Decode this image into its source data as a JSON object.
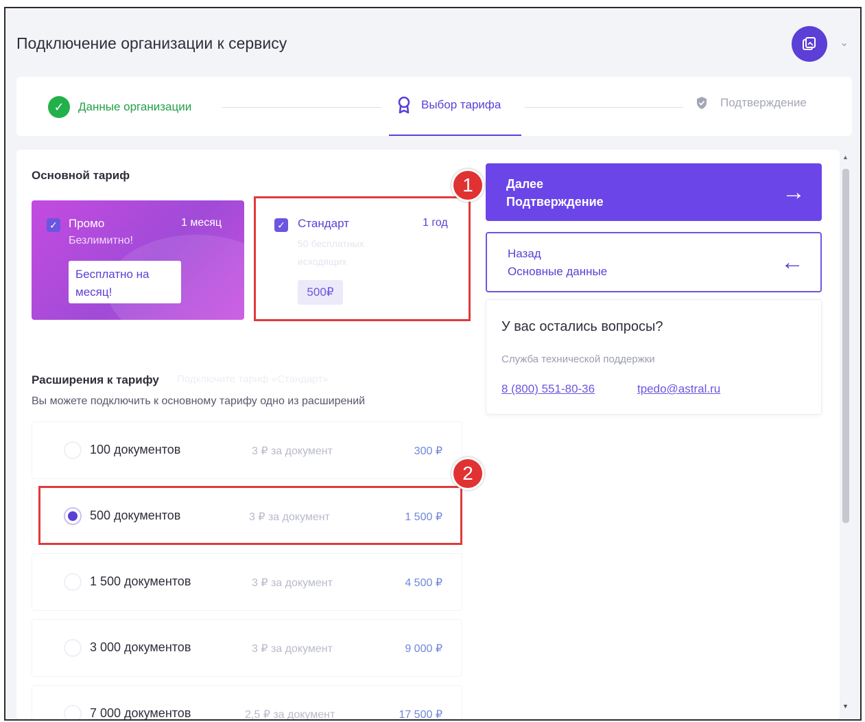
{
  "header": {
    "title": "Подключение организации к сервису"
  },
  "stepper": {
    "steps": [
      {
        "label": "Данные организации",
        "state": "done"
      },
      {
        "label": "Выбор тарифа",
        "state": "active"
      },
      {
        "label": "Подтверждение",
        "state": "pending"
      }
    ]
  },
  "tariff": {
    "title": "Основной тариф",
    "promo": {
      "name": "Промо",
      "period": "1 месяц",
      "subtitle": "Безлимитно!",
      "free_label": "Бесплатно на месяц!"
    },
    "standard": {
      "name": "Стандарт",
      "period": "1 год",
      "subtitle": "50 бесплатных исходящих",
      "price": "500₽"
    }
  },
  "extensions": {
    "title": "Расширения к тарифу",
    "faint_note": "Подключите тариф «Стандарт»",
    "description": "Вы можете подключить к основному тарифу одно из расширений",
    "options": [
      {
        "name": "100 документов",
        "unit": "3 ₽ за документ",
        "price": "300 ₽",
        "selected": false
      },
      {
        "name": "500 документов",
        "unit": "3 ₽ за документ",
        "price": "1 500 ₽",
        "selected": true
      },
      {
        "name": "1 500 документов",
        "unit": "3 ₽ за документ",
        "price": "4 500 ₽",
        "selected": false
      },
      {
        "name": "3 000 документов",
        "unit": "3 ₽ за документ",
        "price": "9 000 ₽",
        "selected": false
      },
      {
        "name": "7 000 документов",
        "unit": "2,5 ₽ за документ",
        "price": "17 500 ₽",
        "selected": false
      }
    ]
  },
  "actions": {
    "next": {
      "line1": "Далее",
      "line2": "Подтверждение"
    },
    "back": {
      "line1": "Назад",
      "line2": "Основные данные"
    }
  },
  "help": {
    "title": "У вас остались вопросы?",
    "subtitle": "Служба технической поддержки",
    "phone": "8 (800) 551-80-36",
    "email": "tpedo@astral.ru"
  },
  "annotations": {
    "badge1": "1",
    "badge2": "2"
  },
  "colors": {
    "accent": "#5b3fd6",
    "success": "#22b04a",
    "highlight": "#e03a3a"
  }
}
